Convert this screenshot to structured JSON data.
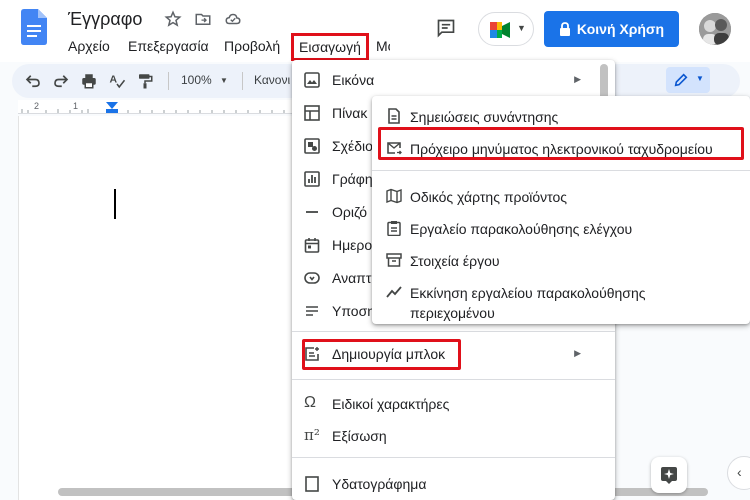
{
  "document": {
    "title": "Έγγραφο"
  },
  "menubar": {
    "items": [
      "Αρχείο",
      "Επεξεργασία",
      "Προβολή",
      "Εισαγωγή",
      "Μο"
    ]
  },
  "header": {
    "share_label": "Κοινή Χρήση"
  },
  "toolbar": {
    "zoom": "100%",
    "style": "Κανονι"
  },
  "ruler": {
    "marks": [
      "2",
      "1"
    ]
  },
  "insert_menu": {
    "items": [
      {
        "label": "Εικόνα",
        "icon": "image-icon",
        "submenu": true
      },
      {
        "label": "Πίνακ",
        "icon": "table-icon"
      },
      {
        "label": "Σχέδιο",
        "icon": "drawing-icon"
      },
      {
        "label": "Γράφη",
        "icon": "chart-icon"
      },
      {
        "label": "Οριζό",
        "icon": "horizontal-line-icon"
      },
      {
        "label": "Ημερο",
        "icon": "calendar-icon"
      },
      {
        "label": "Αναπτ",
        "icon": "dropdown-icon"
      },
      {
        "label": "Υποση",
        "icon": "footnote-icon"
      },
      {
        "label": "Δημιουργία μπλοκ",
        "icon": "building-blocks-icon",
        "submenu": true
      },
      {
        "label": "Ειδικοί χαρακτήρες",
        "icon": "omega-icon"
      },
      {
        "label": "Εξίσωση",
        "icon": "pi-icon"
      },
      {
        "label": "Υδατογράφημα",
        "icon": "watermark-icon"
      }
    ]
  },
  "blocks_submenu": {
    "items": [
      {
        "label": "Σημειώσεις συνάντησης",
        "icon": "meeting-notes-icon"
      },
      {
        "label": "Πρόχειρο μηνύματος ηλεκτρονικού ταχυδρομείου",
        "icon": "email-draft-icon"
      },
      {
        "label": "Οδικός χάρτης προϊόντος",
        "icon": "roadmap-icon"
      },
      {
        "label": "Εργαλείο παρακολούθησης ελέγχου",
        "icon": "review-tracker-icon"
      },
      {
        "label": "Στοιχεία έργου",
        "icon": "project-assets-icon"
      },
      {
        "label": "Εκκίνηση εργαλείου παρακολούθησης",
        "label2": "περιεχομένου",
        "icon": "content-tracker-icon"
      }
    ]
  },
  "colors": {
    "accent": "#1a73e8",
    "highlight": "#e0101a"
  }
}
